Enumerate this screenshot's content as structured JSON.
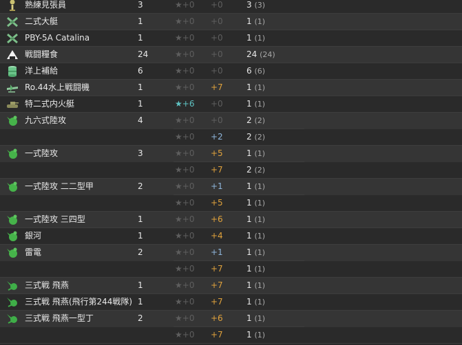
{
  "columns": [
    "name",
    "count",
    "improvement",
    "proficiency",
    "total"
  ],
  "rows": [
    {
      "icon": "lookout-icon",
      "name": "熟練見張員",
      "count": "3",
      "star": "★+0",
      "prof": "+0",
      "prof_kind": "none",
      "total": "3",
      "total_paren": "(3)"
    },
    {
      "icon": "flying-boat-icon",
      "name": "二式大艇",
      "count": "1",
      "star": "★+0",
      "prof": "+0",
      "prof_kind": "none",
      "total": "1",
      "total_paren": "(1)"
    },
    {
      "icon": "flying-boat-icon",
      "name": "PBY-5A Catalina",
      "count": "1",
      "star": "★+0",
      "prof": "+0",
      "prof_kind": "none",
      "total": "1",
      "total_paren": "(1)"
    },
    {
      "icon": "rations-icon",
      "name": "戦闘糧食",
      "count": "24",
      "star": "★+0",
      "prof": "+0",
      "prof_kind": "none",
      "total": "24",
      "total_paren": "(24)"
    },
    {
      "icon": "supply-drum-icon",
      "name": "洋上補給",
      "count": "6",
      "star": "★+0",
      "prof": "+0",
      "prof_kind": "none",
      "total": "6",
      "total_paren": "(6)"
    },
    {
      "icon": "seaplane-fighter-icon",
      "name": "Ro.44水上戦闘機",
      "count": "1",
      "star": "★+0",
      "prof": "+7",
      "prof_kind": "max",
      "total": "1",
      "total_paren": "(1)"
    },
    {
      "icon": "amphibious-tank-icon",
      "name": "特二式内火艇",
      "count": "1",
      "star": "★+6",
      "star_on": true,
      "prof": "+0",
      "prof_kind": "none",
      "total": "1",
      "total_paren": "(1)"
    },
    {
      "icon": "land-attacker-icon",
      "name": "九六式陸攻",
      "count": "4",
      "star": "★+0",
      "prof": "+0",
      "prof_kind": "none",
      "total": "2",
      "total_paren": "(2)"
    },
    {
      "icon": "",
      "name": "",
      "count": "",
      "star": "★+0",
      "prof": "+2",
      "prof_kind": "low",
      "total": "2",
      "total_paren": "(2)"
    },
    {
      "icon": "land-attacker-icon",
      "name": "一式陸攻",
      "count": "3",
      "star": "★+0",
      "prof": "+5",
      "prof_kind": "max",
      "total": "1",
      "total_paren": "(1)"
    },
    {
      "icon": "",
      "name": "",
      "count": "",
      "star": "★+0",
      "prof": "+7",
      "prof_kind": "max",
      "total": "2",
      "total_paren": "(2)"
    },
    {
      "icon": "land-attacker-icon",
      "name": "一式陸攻 二二型甲",
      "count": "2",
      "star": "★+0",
      "prof": "+1",
      "prof_kind": "low",
      "total": "1",
      "total_paren": "(1)"
    },
    {
      "icon": "",
      "name": "",
      "count": "",
      "star": "★+0",
      "prof": "+5",
      "prof_kind": "max",
      "total": "1",
      "total_paren": "(1)"
    },
    {
      "icon": "land-attacker-icon",
      "name": "一式陸攻 三四型",
      "count": "1",
      "star": "★+0",
      "prof": "+6",
      "prof_kind": "max",
      "total": "1",
      "total_paren": "(1)"
    },
    {
      "icon": "land-attacker-icon",
      "name": "銀河",
      "count": "1",
      "star": "★+0",
      "prof": "+4",
      "prof_kind": "max",
      "total": "1",
      "total_paren": "(1)"
    },
    {
      "icon": "land-attacker-icon",
      "name": "雷電",
      "count": "2",
      "star": "★+0",
      "prof": "+1",
      "prof_kind": "low",
      "total": "1",
      "total_paren": "(1)"
    },
    {
      "icon": "",
      "name": "",
      "count": "",
      "star": "★+0",
      "prof": "+7",
      "prof_kind": "max",
      "total": "1",
      "total_paren": "(1)"
    },
    {
      "icon": "land-fighter-icon",
      "name": "三式戦 飛燕",
      "count": "1",
      "star": "★+0",
      "prof": "+7",
      "prof_kind": "max",
      "total": "1",
      "total_paren": "(1)"
    },
    {
      "icon": "land-fighter-icon",
      "name": "三式戦 飛燕(飛行第244戦隊)",
      "count": "1",
      "star": "★+0",
      "prof": "+7",
      "prof_kind": "max",
      "total": "1",
      "total_paren": "(1)"
    },
    {
      "icon": "land-fighter-icon",
      "name": "三式戦 飛燕一型丁",
      "count": "2",
      "star": "★+0",
      "prof": "+6",
      "prof_kind": "max",
      "total": "1",
      "total_paren": "(1)"
    },
    {
      "icon": "",
      "name": "",
      "count": "",
      "star": "★+0",
      "prof": "+7",
      "prof_kind": "max",
      "total": "1",
      "total_paren": "(1)"
    }
  ]
}
